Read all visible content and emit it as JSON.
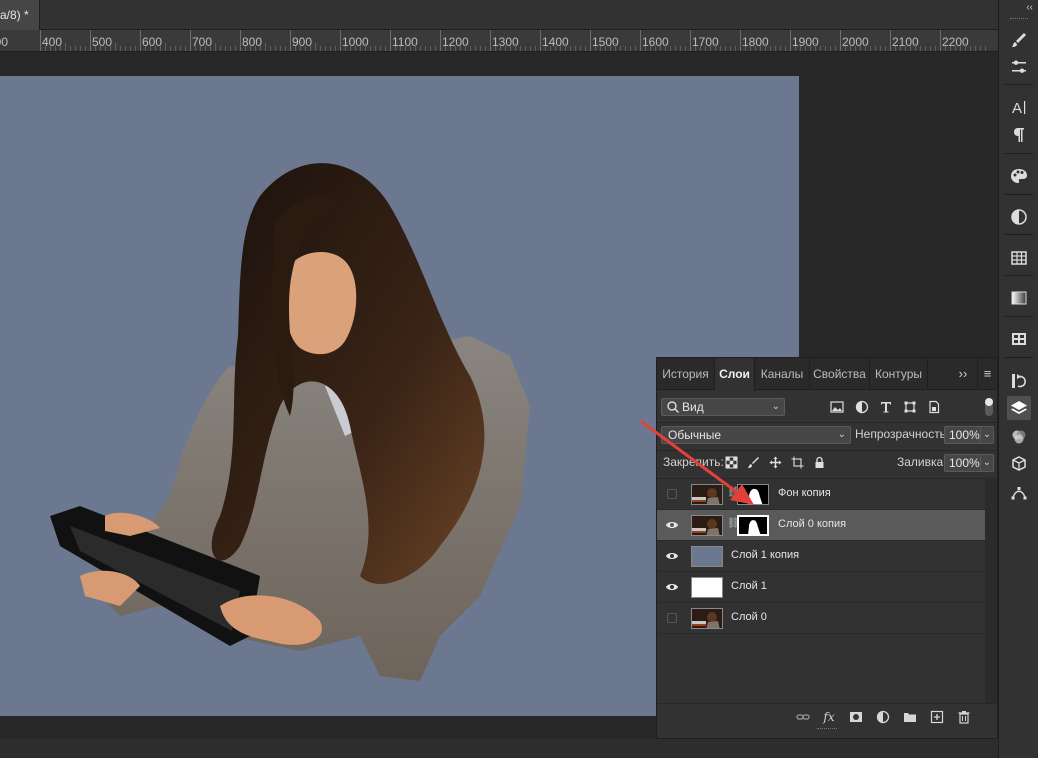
{
  "document": {
    "tab_title": "a/8) *"
  },
  "ruler": {
    "labels": [
      "400",
      "500",
      "600",
      "700",
      "800",
      "900",
      "1000",
      "1100",
      "1200",
      "1300",
      "1400",
      "1500",
      "1600",
      "1700",
      "1800",
      "1900",
      "2000",
      "2100",
      "2200"
    ]
  },
  "panel": {
    "tabs": [
      {
        "label": "История",
        "active": false
      },
      {
        "label": "Слои",
        "active": true
      },
      {
        "label": "Каналы",
        "active": false
      },
      {
        "label": "Свойства",
        "active": false
      },
      {
        "label": "Контуры",
        "active": false
      }
    ],
    "more_label": "››",
    "menu_label": "≡",
    "filter": {
      "kind_value": "Вид"
    },
    "blend": {
      "mode_value": "Обычные",
      "opacity_label": "Непрозрачность:",
      "opacity_value": "100%"
    },
    "lock": {
      "label": "Закрепить:",
      "fill_label": "Заливка:",
      "fill_value": "100%"
    },
    "layers": [
      {
        "name": "Фон копия",
        "visible": false,
        "selected": false,
        "thumb": "photo",
        "has_mask": true
      },
      {
        "name": "Слой 0 копия",
        "visible": true,
        "selected": true,
        "thumb": "photo",
        "has_mask": true
      },
      {
        "name": "Слой 1 копия",
        "visible": true,
        "selected": false,
        "thumb": "slate",
        "has_mask": false
      },
      {
        "name": "Слой 1",
        "visible": true,
        "selected": false,
        "thumb": "white",
        "has_mask": false
      },
      {
        "name": "Слой 0",
        "visible": false,
        "selected": false,
        "thumb": "photo",
        "has_mask": false
      }
    ],
    "bottom_fx_label": "fx"
  },
  "colors": {
    "artboard": "#6c7890",
    "slate_layer": "#6c7890",
    "annotation_arrow": "#e2413a"
  },
  "right_strip_icons": [
    "brush-icon",
    "adjust-sliders-icon",
    "character-icon",
    "paragraph-icon",
    "swatches-icon",
    "adjustments-icon",
    "table-icon",
    "gradient-icon",
    "libraries-icon",
    "history-icon",
    "layers-icon",
    "channels-icon",
    "3d-icon",
    "paths-icon"
  ]
}
